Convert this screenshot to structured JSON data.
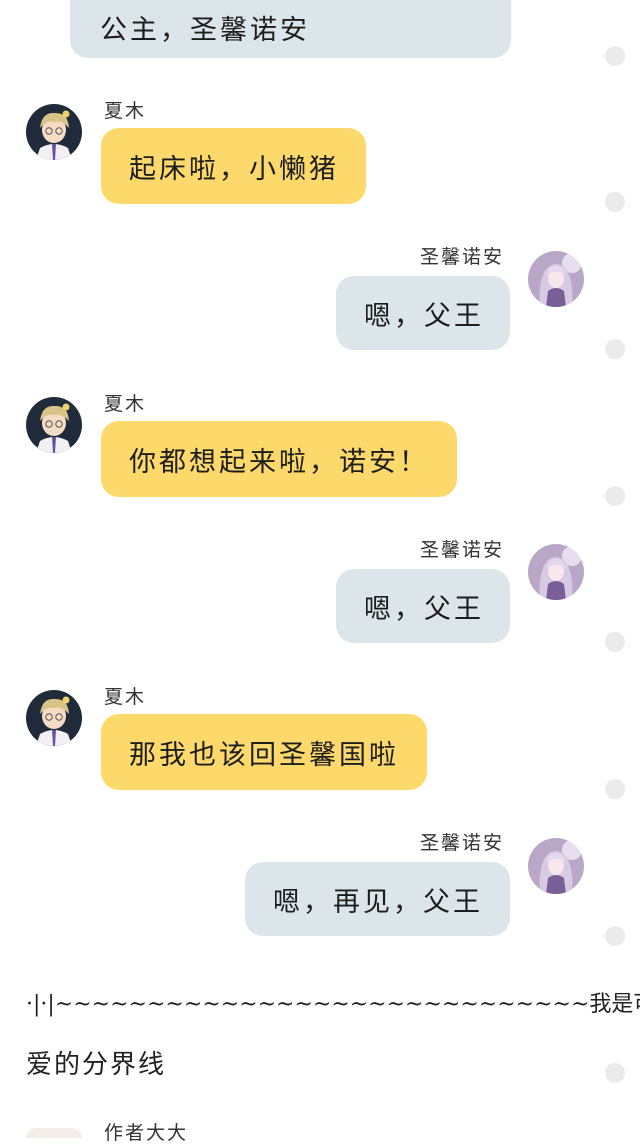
{
  "messages": [
    {
      "text": "公主，圣馨诺安"
    },
    {
      "sender": "夏木",
      "text": "起床啦，小懒猪"
    },
    {
      "sender": "圣馨诺安",
      "text": "嗯，父王"
    },
    {
      "sender": "夏木",
      "text": "你都想起来啦，诺安！"
    },
    {
      "sender": "圣馨诺安",
      "text": "嗯，父王"
    },
    {
      "sender": "夏木",
      "text": "那我也该回圣馨国啦"
    },
    {
      "sender": "圣馨诺安",
      "text": "嗯，再见，父王"
    }
  ],
  "divider": {
    "line1": "·|·|~~~~~~~~~~~~~~~~~~~~~~~~~~~~~我是可",
    "line2": "爱的分界线"
  },
  "next_sender": "作者大大",
  "colors": {
    "left_bubble": "#fdd96b",
    "right_bubble": "#dce5ea",
    "select_dot": "#ebebeb",
    "background": "#ffffff"
  },
  "icons": {
    "left_avatar": "boy-avatar",
    "right_avatar": "girl-avatar",
    "select_dot": "select-circle-icon"
  }
}
